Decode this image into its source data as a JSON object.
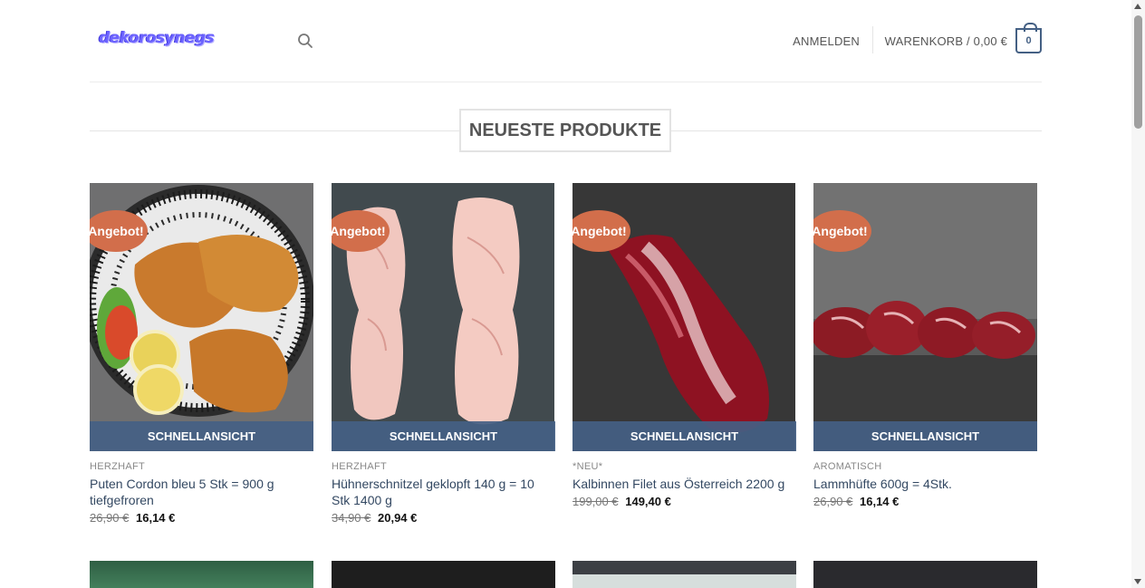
{
  "header": {
    "logo_text": "dekorosynegs",
    "login_label": "ANMELDEN",
    "cart_label": "WARENKORB / 0,00 €",
    "cart_count": "0"
  },
  "section": {
    "title": "NEUESTE PRODUKTE"
  },
  "products": [
    {
      "badge": "Angebot!",
      "quickview": "SCHNELLANSICHT",
      "category": "HERZHAFT",
      "title": "Puten Cordon bleu 5 Stk = 900 g tiefgefroren",
      "old_price": "26,90 €",
      "new_price": "16,14 €"
    },
    {
      "badge": "Angebot!",
      "quickview": "SCHNELLANSICHT",
      "category": "HERZHAFT",
      "title": "Hühnerschnitzel geklopft 140 g = 10 Stk 1400 g",
      "old_price": "34,90 €",
      "new_price": "20,94 €"
    },
    {
      "badge": "Angebot!",
      "quickview": "SCHNELLANSICHT",
      "category": "*NEU*",
      "title": "Kalbinnen Filet aus Österreich 2200 g",
      "old_price": "199,00 €",
      "new_price": "149,40 €"
    },
    {
      "badge": "Angebot!",
      "quickview": "SCHNELLANSICHT",
      "category": "AROMATISCH",
      "title": "Lammhüfte 600g = 4Stk.",
      "old_price": "26,90 €",
      "new_price": "16,14 €"
    }
  ],
  "colors": {
    "accent": "#446084",
    "badge": "#d26e4b",
    "link": "#334862"
  }
}
